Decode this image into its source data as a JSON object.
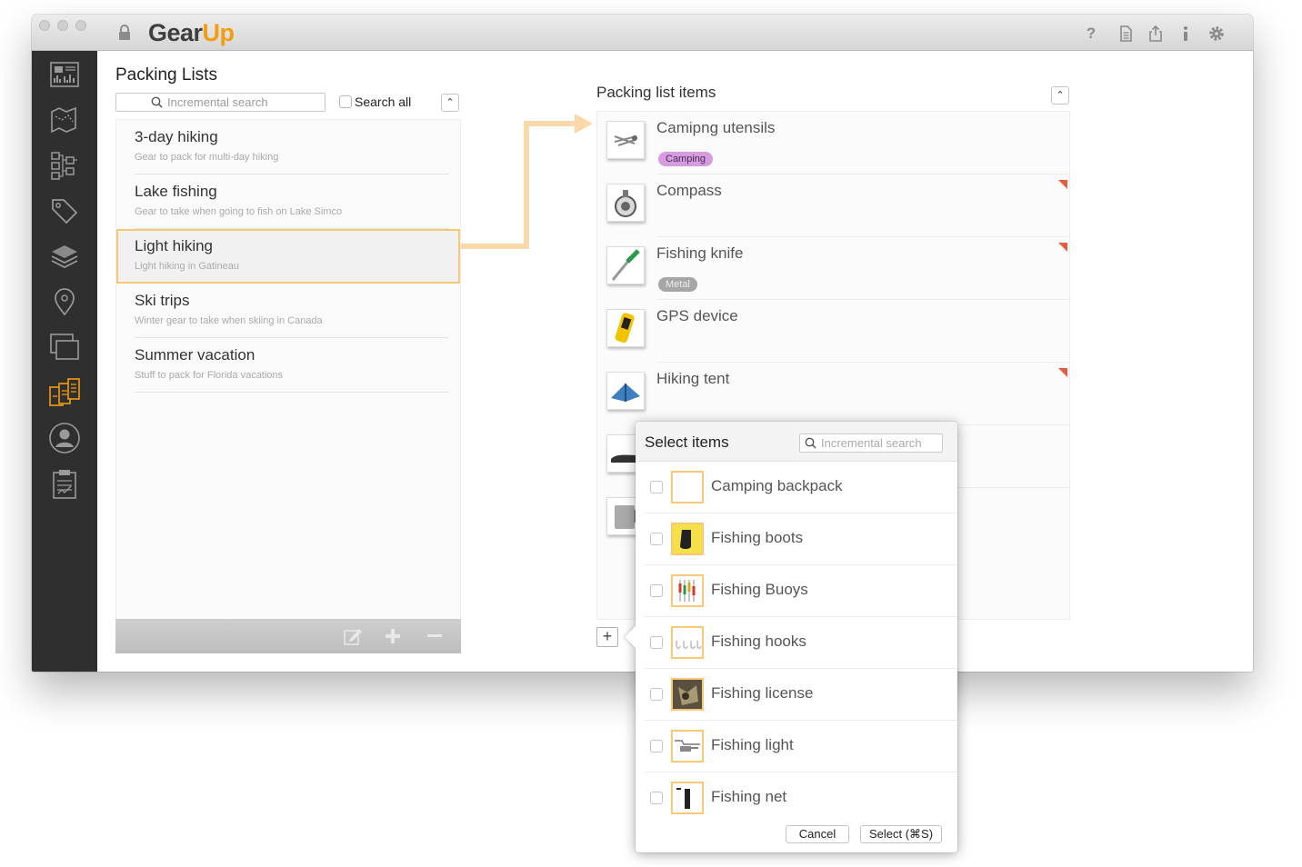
{
  "app": {
    "brand_part1": "Gear",
    "brand_part2": "Up",
    "accent_color": "#f39c12",
    "toolbar_icons": [
      "question-icon",
      "document-icon",
      "share-icon",
      "info-icon",
      "gear-icon"
    ]
  },
  "sidebar": {
    "items": [
      "dashboard-icon",
      "map-icon",
      "hierarchy-icon",
      "tag-icon",
      "layers-icon",
      "location-pin-icon",
      "windows-icon",
      "packing-lists-icon",
      "user-icon",
      "clipboard-icon"
    ],
    "active": "packing-lists-icon"
  },
  "packing_lists": {
    "title": "Packing Lists",
    "search_placeholder": "Incremental search",
    "search_all_label": "Search all",
    "items": [
      {
        "name": "3-day hiking",
        "desc": "Gear to pack for multi-day hiking"
      },
      {
        "name": "Lake fishing",
        "desc": "Gear to take when going to fish on Lake Simco"
      },
      {
        "name": "Light hiking",
        "desc": "Light hiking in Gatineau"
      },
      {
        "name": "Ski trips",
        "desc": "Winter gear to take when skiing in Canada"
      },
      {
        "name": "Summer vacation",
        "desc": "Stuff to pack for Florida vacations"
      }
    ],
    "selected_index": 2
  },
  "packing_items": {
    "title": "Packing list items",
    "items": [
      {
        "name": "Camipng utensils",
        "tag": "Camping",
        "flag": false
      },
      {
        "name": "Compass",
        "tag": "",
        "flag": true
      },
      {
        "name": "Fishing knife",
        "tag": "Metal",
        "flag": true
      },
      {
        "name": "GPS device",
        "tag": "",
        "flag": false
      },
      {
        "name": "Hiking tent",
        "tag": "",
        "flag": true
      }
    ],
    "add_label": "+"
  },
  "select_popover": {
    "title": "Select items",
    "search_placeholder": "Incremental search",
    "items": [
      {
        "name": "Camping backpack"
      },
      {
        "name": "Fishing boots"
      },
      {
        "name": "Fishing Buoys"
      },
      {
        "name": "Fishing hooks"
      },
      {
        "name": "Fishing license"
      },
      {
        "name": "Fishing light"
      },
      {
        "name": "Fishing net"
      }
    ],
    "cancel_label": "Cancel",
    "select_label": "Select (⌘S)"
  }
}
